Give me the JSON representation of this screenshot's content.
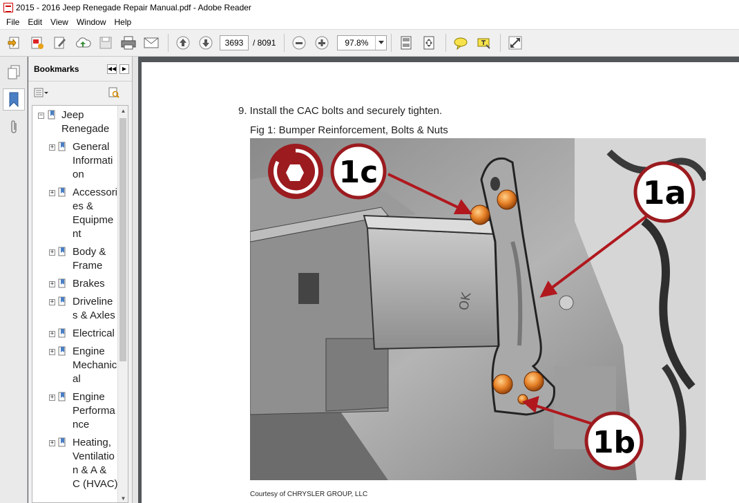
{
  "window": {
    "title": "2015 - 2016 Jeep Renegade Repair Manual.pdf - Adobe Reader"
  },
  "menu": [
    "File",
    "Edit",
    "View",
    "Window",
    "Help"
  ],
  "toolbar": {
    "icons": [
      "create-pdf-icon",
      "export-pdf-icon",
      "edit-icon",
      "upload-cloud-icon",
      "save-icon",
      "print-icon",
      "email-icon",
      "page-up-icon",
      "page-down-icon",
      "zoom-out-icon",
      "zoom-in-icon",
      "fit-page-icon",
      "fit-width-icon",
      "comment-icon",
      "highlight-icon",
      "expand-icon"
    ],
    "current_page": "3693",
    "total_pages": "/ 8091",
    "zoom": "97.8%"
  },
  "bookmarks": {
    "title": "Bookmarks",
    "root": {
      "label_lines": [
        "Jeep",
        "Renegade"
      ]
    },
    "items": [
      {
        "label_lines": [
          "General",
          "Informati",
          "on"
        ]
      },
      {
        "label_lines": [
          "Accessori",
          "es &",
          "Equipme",
          "nt"
        ]
      },
      {
        "label_lines": [
          "Body &",
          "Frame"
        ]
      },
      {
        "label_lines": [
          "Brakes"
        ]
      },
      {
        "label_lines": [
          "Driveline",
          "s & Axles"
        ]
      },
      {
        "label_lines": [
          "Electrical"
        ]
      },
      {
        "label_lines": [
          "Engine",
          "Mechanic",
          "al"
        ]
      },
      {
        "label_lines": [
          "Engine",
          "Performa",
          "nce"
        ]
      },
      {
        "label_lines": [
          "Heating,",
          "Ventilatio",
          "n & A &",
          "C (HVAC)"
        ]
      }
    ]
  },
  "document": {
    "step": "9. Install the CAC bolts and securely tighten.",
    "figure_caption": "Fig 1: Bumper Reinforcement, Bolts & Nuts",
    "callouts": {
      "a": "1a",
      "b": "1b",
      "c": "1c"
    },
    "courtesy": "Courtesy of CHRYSLER GROUP, LLC"
  }
}
